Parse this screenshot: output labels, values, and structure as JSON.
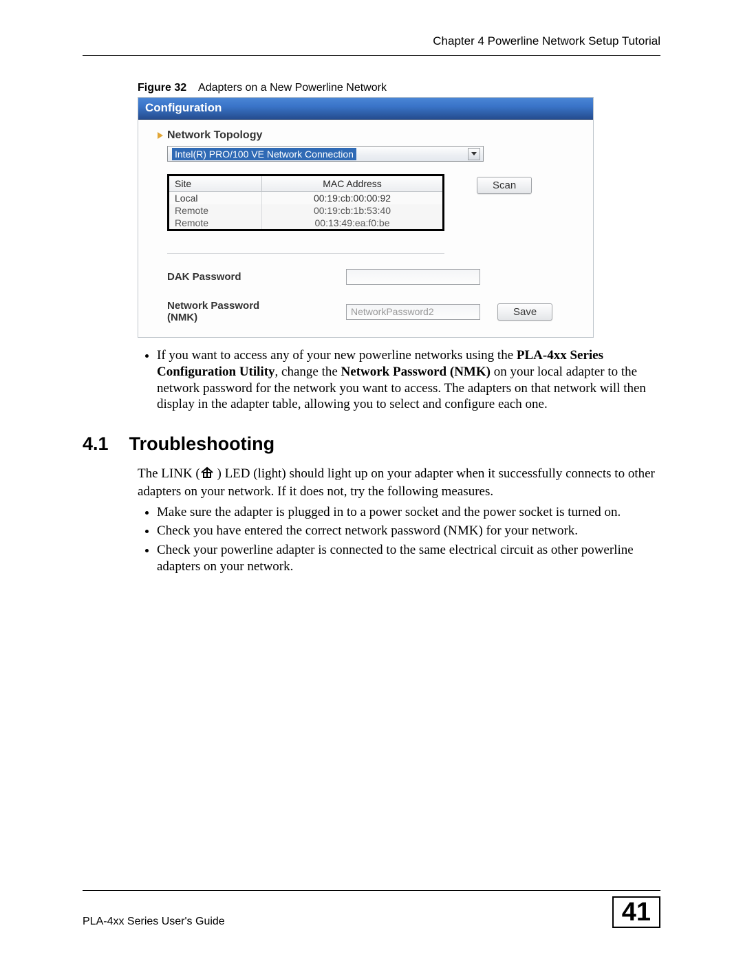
{
  "header": {
    "chapter": "Chapter 4 Powerline Network Setup Tutorial"
  },
  "figure": {
    "label": "Figure 32",
    "caption": "Adapters on a New Powerline Network"
  },
  "screenshot": {
    "title": "Configuration",
    "section": "Network Topology",
    "dropdown_selected": "Intel(R) PRO/100 VE Network Connection",
    "scan_label": "Scan",
    "table": {
      "headers": {
        "site": "Site",
        "mac": "MAC Address"
      },
      "rows": [
        {
          "site": "Local",
          "mac": "00:19:cb:00:00:92"
        },
        {
          "site": "Remote",
          "mac": "00:19:cb:1b:53:40"
        },
        {
          "site": "Remote",
          "mac": "00:13:49:ea:f0:be"
        }
      ]
    },
    "dak_label": "DAK Password",
    "nmk_label": "Network Password (NMK)",
    "nmk_value": "NetworkPassword2",
    "save_label": "Save"
  },
  "body": {
    "bullet1_pre": "If you want to access any of your new powerline networks using the ",
    "bullet1_b1": "PLA-4xx Series Configuration Utility",
    "bullet1_mid": ", change the ",
    "bullet1_b2": "Network Password (NMK)",
    "bullet1_post": " on your local adapter to the network password for the network you want to access. The adapters on that network will then display in the adapter table, allowing you to select and configure each one.",
    "section_num": "4.1",
    "section_title": "Troubleshooting",
    "ts_para_pre": "The LINK (",
    "ts_para_post": ") LED (light) should light up on your adapter when it successfully connects to other adapters on your network. If it does not, try the following measures.",
    "ts_bullets": [
      "Make sure the adapter is plugged in to a power socket and the power socket is turned on.",
      "Check you have entered the correct network password (NMK) for your network.",
      "Check your powerline adapter is connected to the same electrical circuit as other powerline adapters on your network."
    ]
  },
  "footer": {
    "guide": "PLA-4xx Series User's Guide",
    "page": "41"
  }
}
